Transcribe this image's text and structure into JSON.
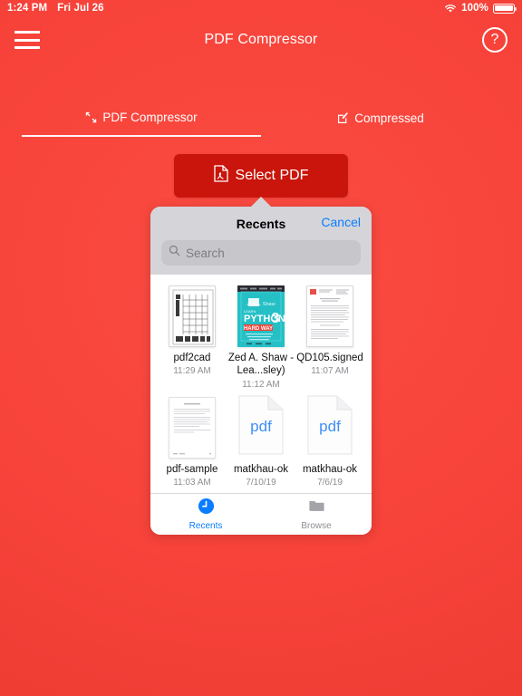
{
  "status_bar": {
    "time": "1:24 PM",
    "date": "Fri Jul 26",
    "battery_percent": "100%",
    "wifi_icon": "wifi-icon",
    "battery_icon": "battery-icon"
  },
  "nav": {
    "menu_icon": "hamburger-menu-icon",
    "title": "PDF Compressor",
    "help_icon": "question-mark-circle-icon",
    "help_label": "?"
  },
  "tabs": [
    {
      "label": "PDF Compressor",
      "icon": "compress-arrows-icon",
      "active": true
    },
    {
      "label": "Compressed",
      "icon": "pencil-square-icon",
      "active": false
    }
  ],
  "select_button": {
    "label": "Select PDF",
    "icon": "pdf-file-icon",
    "color": "#c9150b"
  },
  "popover": {
    "title": "Recents",
    "cancel_label": "Cancel",
    "search": {
      "placeholder": "Search",
      "value": "",
      "icon": "search-icon"
    },
    "files": [
      {
        "name": "pdf2cad",
        "date": "11:29 AM",
        "thumb": "cad-drawing"
      },
      {
        "name": "Zed A. Shaw - Lea...sley)",
        "date": "11:12 AM",
        "thumb": "book-cover-python3"
      },
      {
        "name": "QD105.signed",
        "date": "11:07 AM",
        "thumb": "text-document-logo"
      },
      {
        "name": "pdf-sample",
        "date": "11:03 AM",
        "thumb": "text-document"
      },
      {
        "name": "matkhau-ok",
        "date": "7/10/19",
        "thumb": "generic-pdf"
      },
      {
        "name": "matkhau-ok",
        "date": "7/6/19",
        "thumb": "generic-pdf"
      }
    ],
    "tabbar": [
      {
        "label": "Recents",
        "icon": "clock-icon",
        "active": true
      },
      {
        "label": "Browse",
        "icon": "folder-icon",
        "active": false
      }
    ]
  },
  "colors": {
    "brand_red": "#f9423a",
    "button_red": "#c9150b",
    "accent_blue": "#0a7cff",
    "popover_header_gray": "#d5d5d9"
  }
}
